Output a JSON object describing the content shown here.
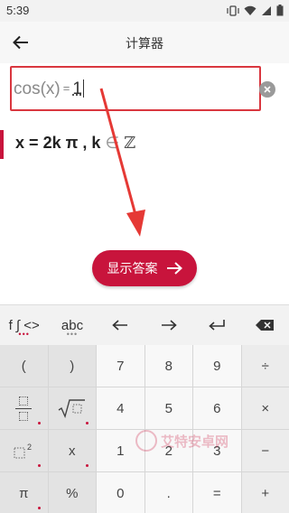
{
  "status_bar": {
    "time": "5:39"
  },
  "app_bar": {
    "title": "计算器"
  },
  "input": {
    "lhs": "cos(x)",
    "eq": "=",
    "value": "1"
  },
  "result": {
    "var1": "x",
    "eq": "=",
    "expr": "2k π",
    "sep": ",",
    "var2": "k",
    "elem": "∈",
    "set": "ℤ"
  },
  "answer_button": {
    "label": "显示答案"
  },
  "keyboard": {
    "top_row": [
      {
        "label": "f ∫ <>",
        "icon": "functions"
      },
      {
        "label": "abc",
        "icon": "letters"
      },
      {
        "label": "←",
        "icon": "arrow-left-icon"
      },
      {
        "label": "→",
        "icon": "arrow-right-icon"
      },
      {
        "label": "↵",
        "icon": "enter-icon"
      },
      {
        "label": "⌫",
        "icon": "backspace-icon"
      }
    ],
    "rows": [
      [
        "(",
        ")",
        "7",
        "8",
        "9",
        "÷"
      ],
      [
        "fraction",
        "sqrt",
        "4",
        "5",
        "6",
        "×"
      ],
      [
        "square",
        "x",
        "1",
        "2",
        "3",
        "−"
      ],
      [
        "π",
        "%",
        "0",
        ".",
        "=",
        "+"
      ]
    ]
  },
  "watermark": {
    "text": "艾特安卓网"
  },
  "colors": {
    "accent": "#c8143c",
    "highlight_box": "#d9373f"
  }
}
